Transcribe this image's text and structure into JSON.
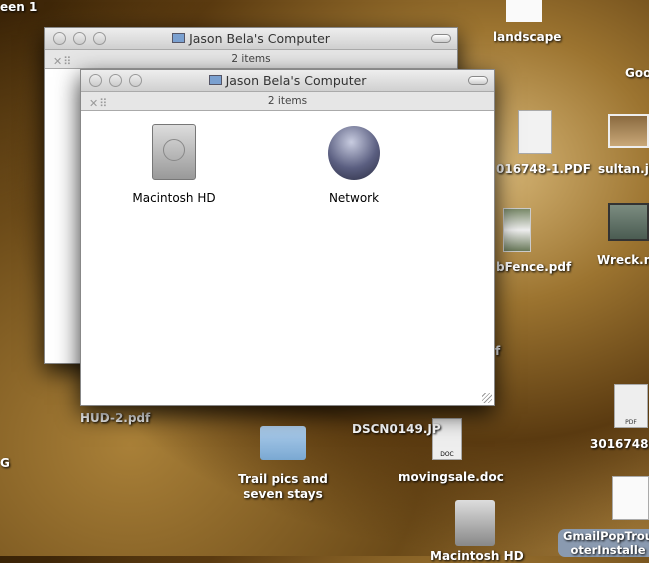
{
  "desktop": {
    "items": [
      {
        "label": "een 1"
      },
      {
        "label": "landscape"
      },
      {
        "label": "Goo"
      },
      {
        "label": "016748-1.PDF"
      },
      {
        "label": "sultan.jp"
      },
      {
        "label": "bFence.pdf"
      },
      {
        "label": "Wreck.m"
      },
      {
        "label": "f"
      },
      {
        "label": "HUD-2.pdf"
      },
      {
        "label": "DSCN0149.JP"
      },
      {
        "label": "Trail pics and seven stays"
      },
      {
        "label": "movingsale.doc"
      },
      {
        "label": "3016748."
      },
      {
        "label": "G"
      },
      {
        "label": "GmailPopTrou oterInstalle"
      },
      {
        "label": "Macintosh HD"
      }
    ]
  },
  "back_window": {
    "title": "Jason Bela's Computer",
    "status": "2 items"
  },
  "front_window": {
    "title": "Jason Bela's Computer",
    "status": "2 items",
    "items": [
      {
        "label": "Macintosh HD",
        "icon": "hard-drive-icon"
      },
      {
        "label": "Network",
        "icon": "network-globe-icon"
      }
    ]
  },
  "icons": {
    "pdf_badge": "PDF",
    "doc_badge": "DOC"
  }
}
